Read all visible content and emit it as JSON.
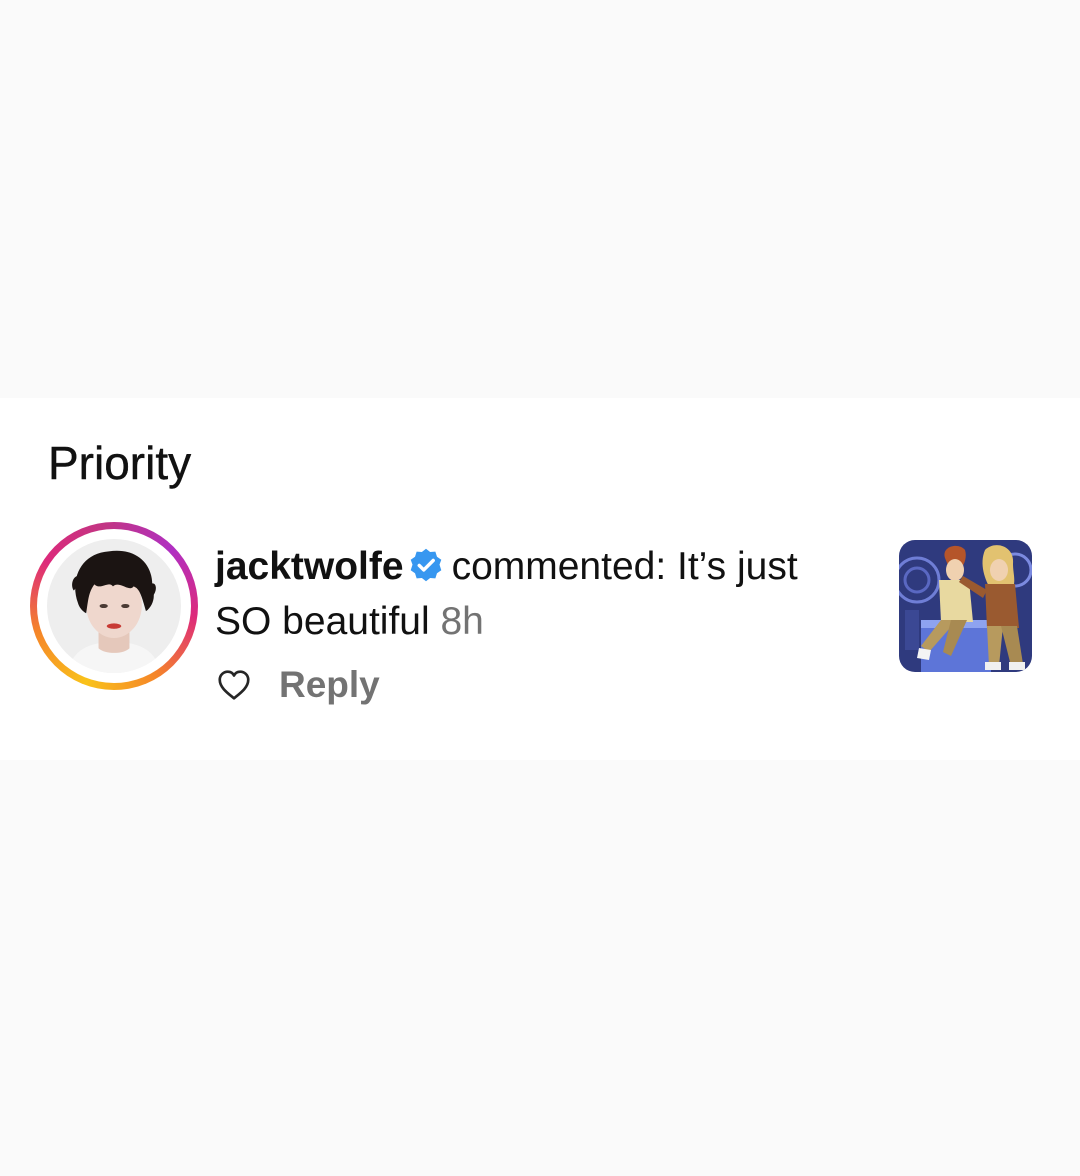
{
  "section": {
    "title": "Priority"
  },
  "notification": {
    "avatar_icon": "avatar-photo",
    "username": "jacktwolfe",
    "verified_icon": "verified-badge-icon",
    "action_text": "commented: It’s just SO beautiful",
    "time": "8h",
    "like_icon": "heart-outline-icon",
    "reply_label": "Reply",
    "thumbnail_icon": "post-thumbnail-illustration"
  },
  "colors": {
    "background": "#fafafa",
    "card": "#ffffff",
    "text": "#111111",
    "secondary_text": "#737373",
    "verified_blue": "#3797f0",
    "story_ring": [
      "#f9c21a",
      "#f58529",
      "#dd2a7b",
      "#c13584"
    ]
  }
}
